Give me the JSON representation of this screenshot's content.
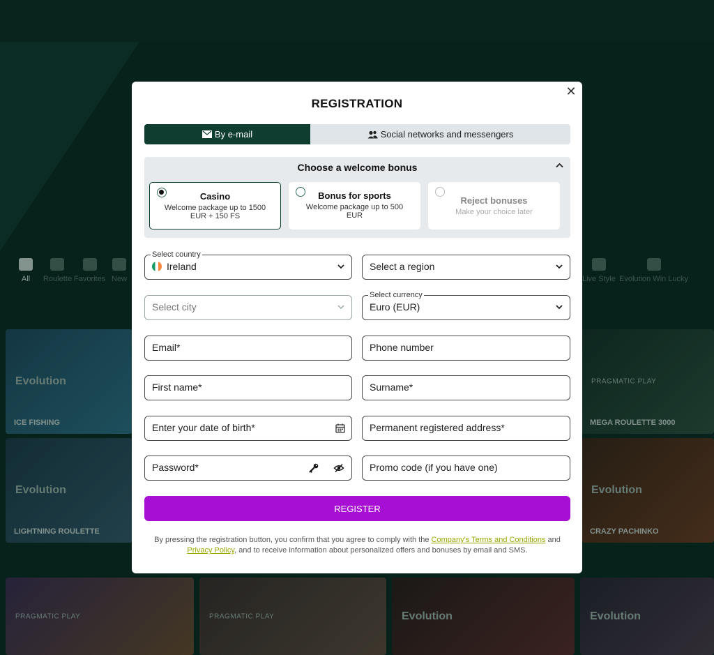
{
  "background": {
    "categories": [
      "All",
      "Roulette",
      "Favorites",
      "New",
      "Live Style",
      "Evolution Win Lucky"
    ],
    "tiles": [
      {
        "brand": "Evolution",
        "name": "ICE FISHING"
      },
      {
        "brand": "PRAGMATIC PLAY",
        "name": "MEGA ROULETTE 3000"
      },
      {
        "brand": "Evolution",
        "name": "LIGHTNING ROULETTE"
      },
      {
        "brand": "Evolution",
        "name": "CRAZY PACHINKO"
      },
      {
        "brand": "PRAGMATIC PLAY",
        "name": ""
      },
      {
        "brand": "PRAGMATIC PLAY",
        "name": ""
      },
      {
        "brand": "Evolution",
        "name": ""
      },
      {
        "brand": "Evolution",
        "name": ""
      }
    ]
  },
  "modal": {
    "close": "✕",
    "title": "REGISTRATION",
    "tabs": {
      "email": "By e-mail",
      "social": "Social networks and messengers"
    },
    "bonus": {
      "title": "Choose a welcome bonus",
      "options": [
        {
          "title": "Casino",
          "subtitle": "Welcome package up to 1500 EUR + 150 FS",
          "selected": true
        },
        {
          "title": "Bonus for sports",
          "subtitle": "Welcome package up to 500 EUR",
          "selected": false
        },
        {
          "title": "Reject bonuses",
          "subtitle": "Make your choice later",
          "selected": false
        }
      ]
    },
    "form": {
      "country": {
        "label": "Select country",
        "value": "Ireland"
      },
      "region": {
        "placeholder": "Select a region"
      },
      "city": {
        "placeholder": "Select city"
      },
      "currency": {
        "label": "Select currency",
        "value": "Euro (EUR)"
      },
      "email": {
        "placeholder": "Email*"
      },
      "phone": {
        "placeholder": "Phone number"
      },
      "first_name": {
        "placeholder": "First name*"
      },
      "surname": {
        "placeholder": "Surname*"
      },
      "dob": {
        "placeholder": "Enter your date of birth*"
      },
      "address": {
        "placeholder": "Permanent registered address*"
      },
      "password": {
        "placeholder": "Password*"
      },
      "promo": {
        "placeholder": "Promo code (if you have one)"
      }
    },
    "register": "REGISTER",
    "legal": {
      "text1": "By pressing the registration button, you confirm that you agree to comply with the ",
      "terms": "Company's Terms and Conditions",
      "and": " and ",
      "privacy": "Privacy Policy",
      "text2": ", and to receive information about personalized offers and bonuses by email and SMS."
    }
  }
}
